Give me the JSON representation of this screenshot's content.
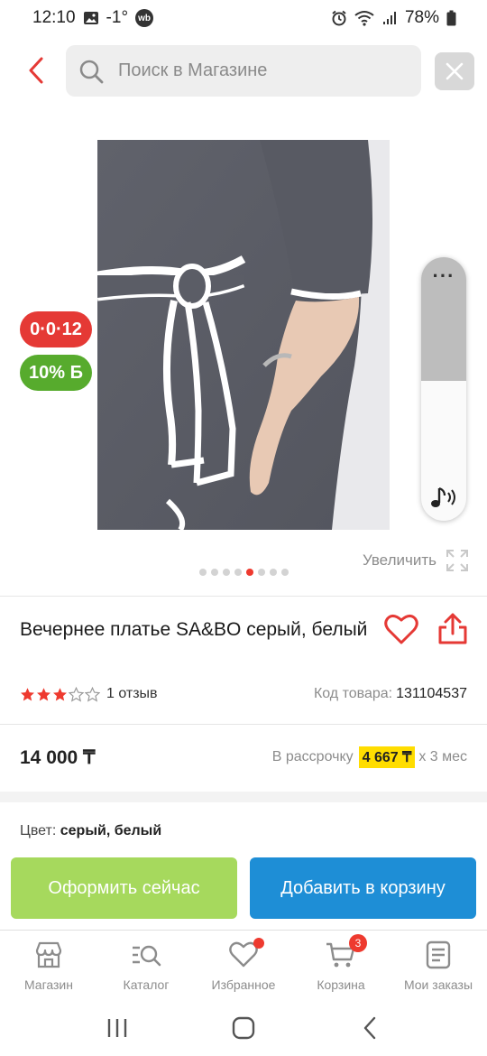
{
  "status_bar": {
    "time": "12:10",
    "weather": "-1°",
    "wb_label": "wb",
    "battery": "78%"
  },
  "search": {
    "placeholder": "Поиск в Магазине"
  },
  "gallery": {
    "promo_badge": "0·0·12",
    "bonus_badge": "10% Б",
    "zoom_label": "Увеличить",
    "page_count": 8,
    "active_page": 5,
    "volume_level": 0.47
  },
  "product": {
    "title": "Вечернее платье SA&BO серый, белый",
    "rating": 3,
    "rating_max": 5,
    "reviews": "1 отзыв",
    "sku_label": "Код товара:",
    "sku_value": "131104537",
    "price": "14 000 ₸",
    "installment_prefix": "В рассрочку",
    "installment_amount": "4 667 ₸",
    "installment_suffix": "x 3 мес",
    "color_label": "Цвет:",
    "color_value": "серый, белый"
  },
  "actions": {
    "buy_now": "Оформить сейчас",
    "add_to_cart": "Добавить в корзину"
  },
  "bottom_nav": [
    {
      "label": "Магазин",
      "icon": "store-icon"
    },
    {
      "label": "Каталог",
      "icon": "catalog-search-icon"
    },
    {
      "label": "Избранное",
      "icon": "heart-icon"
    },
    {
      "label": "Корзина",
      "icon": "cart-icon",
      "badge": "3"
    },
    {
      "label": "Мои заказы",
      "icon": "orders-icon"
    }
  ],
  "colors": {
    "accent_red": "#ee3a2f",
    "buy_green": "#a6d95d",
    "cart_blue": "#1e8ed6",
    "bonus_green": "#57ab2d",
    "installment_yellow": "#ffdd00"
  }
}
